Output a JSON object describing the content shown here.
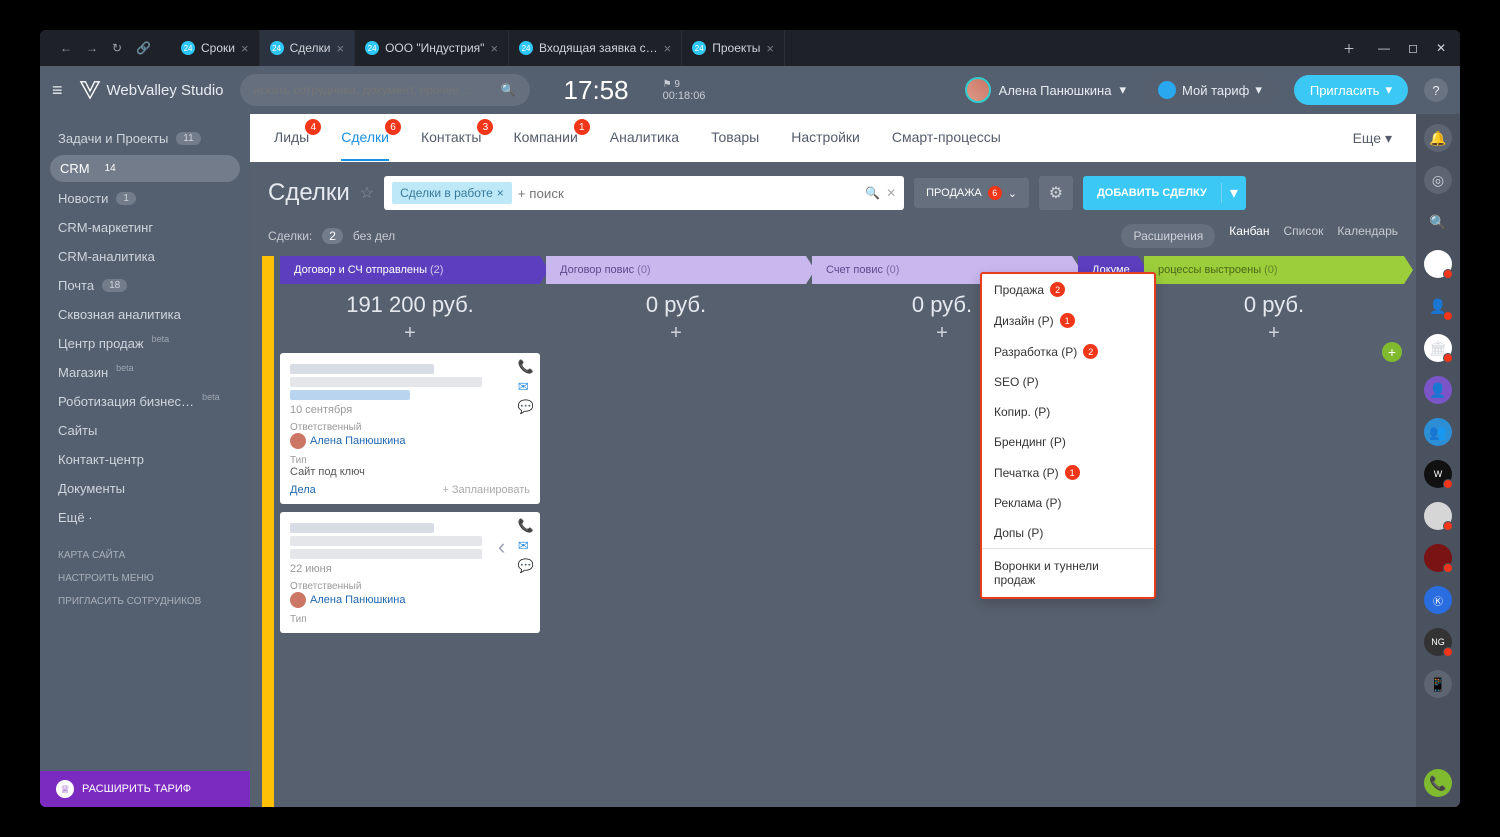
{
  "browser": {
    "tabs": [
      {
        "label": "Сроки"
      },
      {
        "label": "Сделки"
      },
      {
        "label": "ООО \"Индустрия\""
      },
      {
        "label": "Входящая заявка с…"
      },
      {
        "label": "Проекты"
      }
    ]
  },
  "header": {
    "brand": "WebValley Studio",
    "search_placeholder": "искать сотрудника, документ, прочее…",
    "clock": "17:58",
    "timer_count": "9",
    "timer": "00:18:06",
    "user": "Алена Панюшкина",
    "tariff": "Мой тариф",
    "invite": "Пригласить"
  },
  "sidebar": {
    "items": [
      {
        "label": "Задачи и Проекты",
        "count": "11"
      },
      {
        "label": "CRM",
        "count": "14",
        "active": true
      },
      {
        "label": "Новости",
        "count": "1"
      },
      {
        "label": "CRM-маркетинг"
      },
      {
        "label": "CRM-аналитика"
      },
      {
        "label": "Почта",
        "count": "18"
      },
      {
        "label": "Сквозная аналитика"
      },
      {
        "label": "Центр продаж",
        "beta": "beta"
      },
      {
        "label": "Магазин",
        "beta": "beta"
      },
      {
        "label": "Роботизация бизнес…",
        "beta": "beta"
      },
      {
        "label": "Сайты"
      },
      {
        "label": "Контакт-центр"
      },
      {
        "label": "Документы"
      },
      {
        "label": "Ещё ·"
      }
    ],
    "sub": [
      "КАРТА САЙТА",
      "НАСТРОИТЬ МЕНЮ",
      "ПРИГЛАСИТЬ СОТРУДНИКОВ"
    ],
    "tariff": "РАСШИРИТЬ ТАРИФ"
  },
  "topnav": {
    "items": [
      {
        "label": "Лиды",
        "badge": "4"
      },
      {
        "label": "Сделки",
        "badge": "6",
        "active": true
      },
      {
        "label": "Контакты",
        "badge": "3"
      },
      {
        "label": "Компании",
        "badge": "1"
      },
      {
        "label": "Аналитика"
      },
      {
        "label": "Товары"
      },
      {
        "label": "Настройки"
      },
      {
        "label": "Смарт-процессы"
      }
    ],
    "more": "Еще"
  },
  "page": {
    "title": "Сделки",
    "filter_chip": "Сделки в работе",
    "filter_placeholder": "+ поиск",
    "funnel": "ПРОДАЖА",
    "funnel_count": "6",
    "add": "ДОБАВИТЬ СДЕЛКУ",
    "deals_label": "Сделки:",
    "deals_count": "2",
    "no_deals": "без дел",
    "extensions": "Расширения",
    "views": [
      "Канбан",
      "Список",
      "Календарь"
    ]
  },
  "dropdown": {
    "items": [
      {
        "label": "Продажа",
        "count": "2"
      },
      {
        "label": "Дизайн (Р)",
        "count": "1"
      },
      {
        "label": "Разработка (Р)",
        "count": "2"
      },
      {
        "label": "SEO (Р)"
      },
      {
        "label": "Копир. (Р)"
      },
      {
        "label": "Брендинг (Р)"
      },
      {
        "label": "Печатка (Р)",
        "count": "1"
      },
      {
        "label": "Реклама (Р)"
      },
      {
        "label": "Допы (Р)"
      }
    ],
    "footer": "Воронки и туннели продаж"
  },
  "kanban": {
    "cols": [
      {
        "title": "Договор и СЧ отправлены",
        "count": "(2)",
        "sum": "191 200 руб.",
        "color": "#5b3fbf"
      },
      {
        "title": "Договор повис",
        "count": "(0)",
        "sum": "0 руб.",
        "color": "#c8b8ee"
      },
      {
        "title": "Счет повис",
        "count": "(0)",
        "sum": "0 руб.",
        "color": "#c8b8ee"
      },
      {
        "title": "Докуме",
        "count": "",
        "sum": "",
        "color": "#5b3fbf"
      },
      {
        "title": "роцессы выстроены",
        "count": "(0)",
        "sum": "0 руб.",
        "color": "#9cce3b"
      }
    ],
    "card1": {
      "date": "10 сентября",
      "resp_label": "Ответственный",
      "person": "Алена Панюшкина",
      "type_label": "Тип",
      "type_value": "Сайт под ключ",
      "deals": "Дела",
      "plan": "+ Запланировать"
    },
    "card2": {
      "date": "22 июня",
      "resp_label": "Ответственный",
      "person": "Алена Панюшкина",
      "type_label": "Тип"
    }
  }
}
